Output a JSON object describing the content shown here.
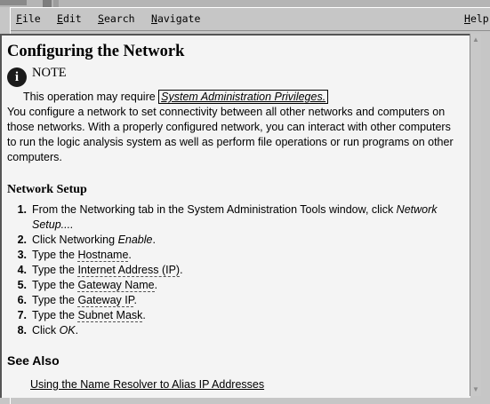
{
  "menu": {
    "file": {
      "accel": "F",
      "rest": "ile"
    },
    "edit": {
      "accel": "E",
      "rest": "dit"
    },
    "search": {
      "accel": "S",
      "rest": "earch"
    },
    "navigate": {
      "accel": "N",
      "rest": "avigate"
    },
    "help": {
      "accel": "H",
      "rest": "elp"
    }
  },
  "page": {
    "title": "Configuring the Network",
    "note_label": "NOTE",
    "note_icon_glyph": "i",
    "note_prefix": "This operation may require ",
    "note_link": "System Administration Privileges.",
    "intro": "You configure a network to set connectivity between all other networks and computers on those networks. With a properly configured network, you can interact with other computers to run the logic analysis system as well as perform file operations or run programs on other computers.",
    "network_setup_heading": "Network Setup",
    "steps": [
      {
        "num": "1.",
        "pre": "From the Networking tab in the System Administration Tools window, click ",
        "em": "Network Setup....",
        "post": ""
      },
      {
        "num": "2.",
        "pre": "Click Networking ",
        "em": "Enable",
        "post": "."
      },
      {
        "num": "3.",
        "pre": "Type the ",
        "link": "Hostname",
        "post": "."
      },
      {
        "num": "4.",
        "pre": "Type the ",
        "link": "Internet Address (IP)",
        "post": "."
      },
      {
        "num": "5.",
        "pre": "Type the ",
        "link": "Gateway Name",
        "post": "."
      },
      {
        "num": "6.",
        "pre": "Type the ",
        "link": "Gateway IP",
        "post": "."
      },
      {
        "num": "7.",
        "pre": "Type the ",
        "link": "Subnet Mask",
        "post": "."
      },
      {
        "num": "8.",
        "pre": "Click ",
        "em": "OK",
        "post": "."
      }
    ],
    "see_also_heading": "See Also",
    "see_also_link": "Using the Name Resolver to Alias IP Addresses"
  }
}
